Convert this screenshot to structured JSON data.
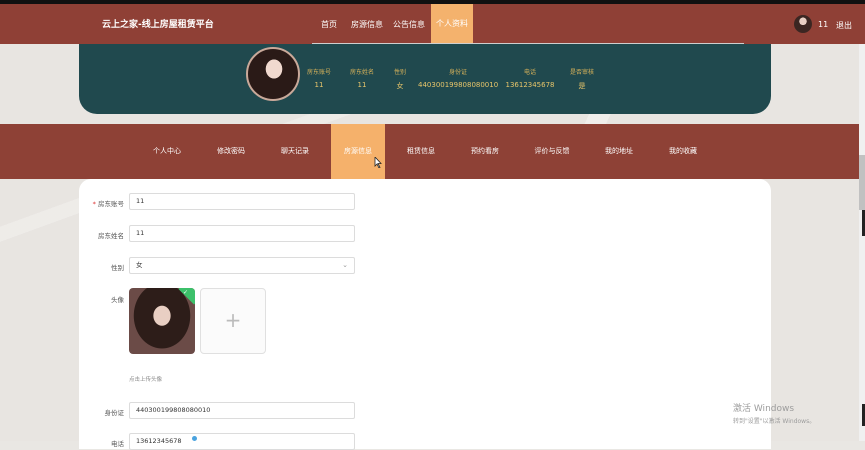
{
  "site": {
    "title": "云上之家-线上房屋租赁平台"
  },
  "nav": {
    "items": [
      "首页",
      "房源信息",
      "公告信息",
      "个人资料"
    ],
    "active_index": 3
  },
  "user": {
    "name": "11",
    "logout": "退出"
  },
  "profile": {
    "columns": [
      {
        "label": "房东账号",
        "value": "11"
      },
      {
        "label": "房东姓名",
        "value": "11"
      },
      {
        "label": "性别",
        "value": "女"
      },
      {
        "label": "身份证",
        "value": "440300199808080010"
      },
      {
        "label": "电话",
        "value": "13612345678"
      },
      {
        "label": "是否审核",
        "value": "是"
      }
    ]
  },
  "tabs": {
    "items": [
      "个人中心",
      "修改密码",
      "聊天记录",
      "房源信息",
      "租赁信息",
      "预约看房",
      "评价与反馈",
      "我的地址",
      "我的收藏"
    ],
    "active_index": 3
  },
  "form": {
    "account_label": "房东账号",
    "account_value": "11",
    "name_label": "房东姓名",
    "name_value": "11",
    "gender_label": "性别",
    "gender_value": "女",
    "avatar_label": "头像",
    "upload_plus": "+",
    "avatar_hint": "点击上传头像",
    "idcard_label": "身份证",
    "idcard_value": "440300199808080010",
    "phone_label": "电话",
    "phone_value": "13612345678"
  },
  "watermark": {
    "line1": "激活 Windows",
    "line2": "转到\"设置\"以激活 Windows。"
  },
  "colors": {
    "topbar": "#8f4036",
    "accent": "#f4b26d",
    "profile_bg": "#20494e",
    "label_gold": "#d9b35a"
  }
}
